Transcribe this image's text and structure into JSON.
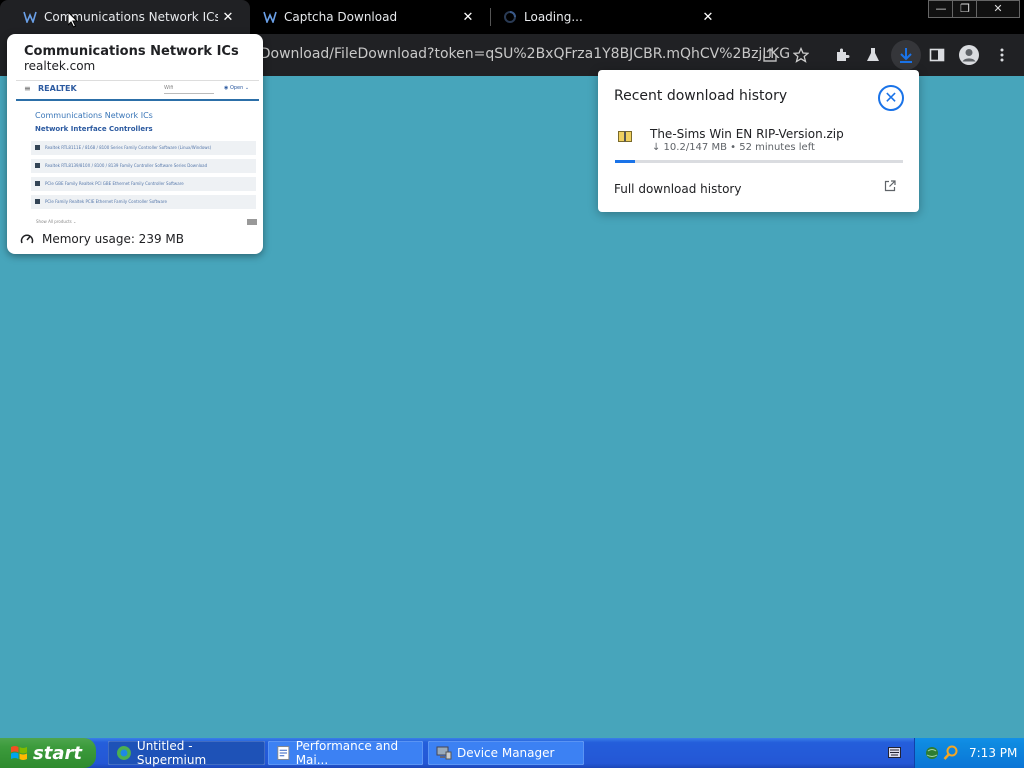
{
  "browser": {
    "tabs": [
      {
        "title": "Communications Network ICs",
        "active": true
      },
      {
        "title": "Captcha Download",
        "active": false
      },
      {
        "title": "Loading...",
        "active": false
      }
    ],
    "tab_close_glyph": "✕",
    "window_controls": {
      "minimize": "—",
      "restore": "❐",
      "close": "✕"
    },
    "address_text": "/Download/FileDownload?token=qSU%2BxQFrza1Y8BJCBR.mQhCV%2BzjLKG...",
    "toolbar_icons": [
      "share-icon",
      "bookmark-star-icon",
      "extensions-icon",
      "labs-flask-icon",
      "download-icon",
      "side-panel-icon",
      "profile-avatar-icon",
      "menu-kebab-icon"
    ]
  },
  "hover_card": {
    "title": "Communications Network ICs",
    "domain": "realtek.com",
    "memory": "Memory usage: 239 MB",
    "thumbnail": {
      "brand": "REALTEK",
      "heading": "Communications Network ICs",
      "subheading": "Network Interface Controllers",
      "search_placeholder": "Wifi",
      "lang": "◉ Open ⌄",
      "rows": [
        "Realtek RTL8111E / 8168 / 8100 Series Family Controller Software (Linux/Windows)",
        "Realtek RTL8139/810X / 8100 / 8139 Family Controller Software Series Download",
        "PCIe GBE Family Realtek PCI GBE Ethernet Family Controller Software",
        "PCIe Family Realtek PCIE Ethernet Family Controller Software"
      ],
      "footer_text": "Show   All products   ⌄"
    }
  },
  "download_bubble": {
    "title": "Recent download history",
    "close_glyph": "✕",
    "file_name": "The-Sims  Win  EN  RIP-Version.zip",
    "status": "↓  10.2/147 MB • 52 minutes left",
    "progress_fraction": 0.069,
    "full_history_label": "Full download history"
  },
  "taskbar": {
    "start_label": "start",
    "buttons": [
      {
        "label": "Untitled - Supermium",
        "active": true
      },
      {
        "label": "Performance and Mai...",
        "active": false
      },
      {
        "label": "Device Manager",
        "active": false
      }
    ],
    "clock": "7:13 PM"
  },
  "colors": {
    "desktop": "#47a5bb",
    "accent": "#1a73e8",
    "taskbar": "#245edb"
  }
}
